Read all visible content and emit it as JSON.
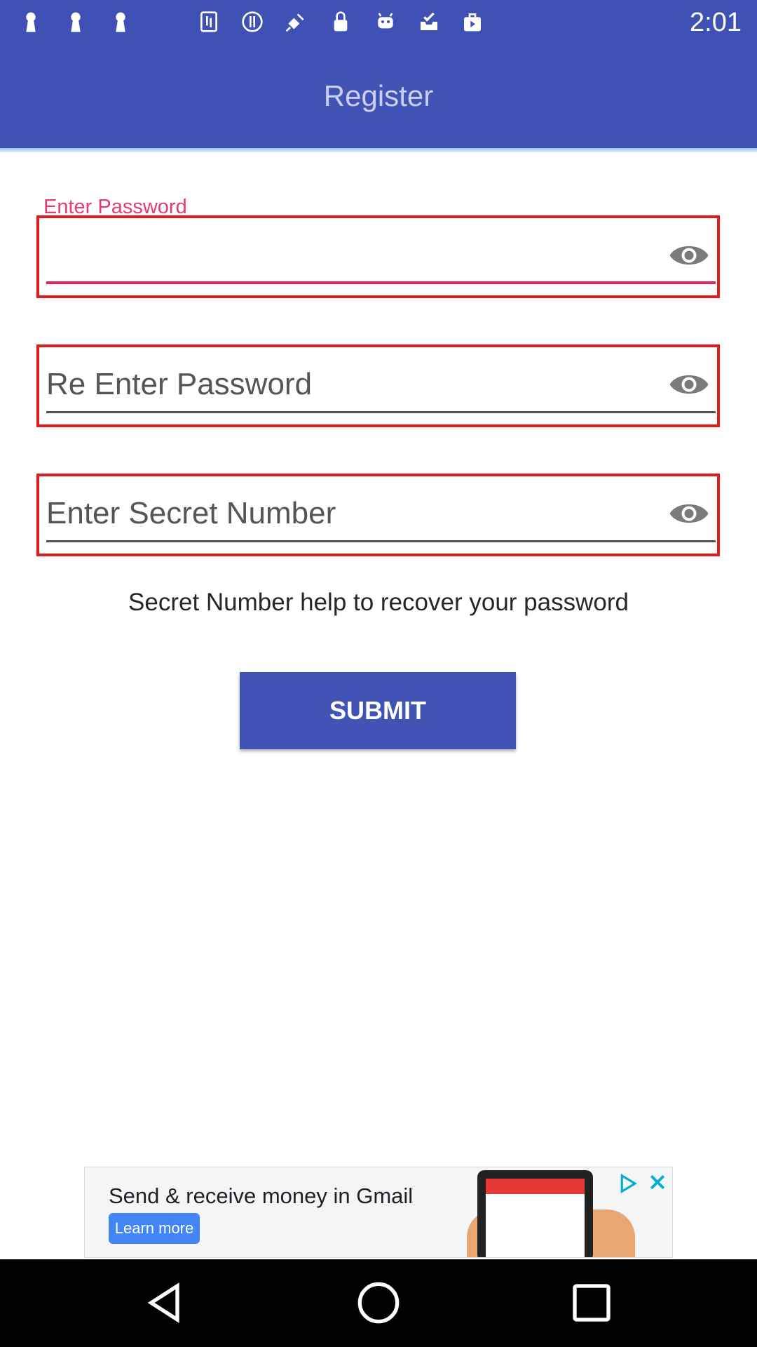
{
  "status_bar": {
    "time": "2:01",
    "icons": [
      "keyhole-icon",
      "keyhole-icon",
      "keyhole-icon",
      "contacts-icon",
      "info-icon",
      "satellite-icon",
      "lock-icon",
      "android-icon",
      "inbox-check-icon",
      "play-bag-icon"
    ]
  },
  "app_bar": {
    "title": "Register"
  },
  "form": {
    "password": {
      "label": "Enter Password",
      "value": ""
    },
    "re_password": {
      "placeholder": "Re Enter Password",
      "value": ""
    },
    "secret": {
      "placeholder": "Enter Secret Number",
      "value": ""
    },
    "helper_text": "Secret Number help to recover your password",
    "submit_label": "SUBMIT"
  },
  "ad": {
    "headline": "Send & receive money in Gmail",
    "cta": "Learn more"
  },
  "colors": {
    "primary": "#4253b6",
    "accent": "#e0245e",
    "highlight_border": "#e21b1b"
  }
}
